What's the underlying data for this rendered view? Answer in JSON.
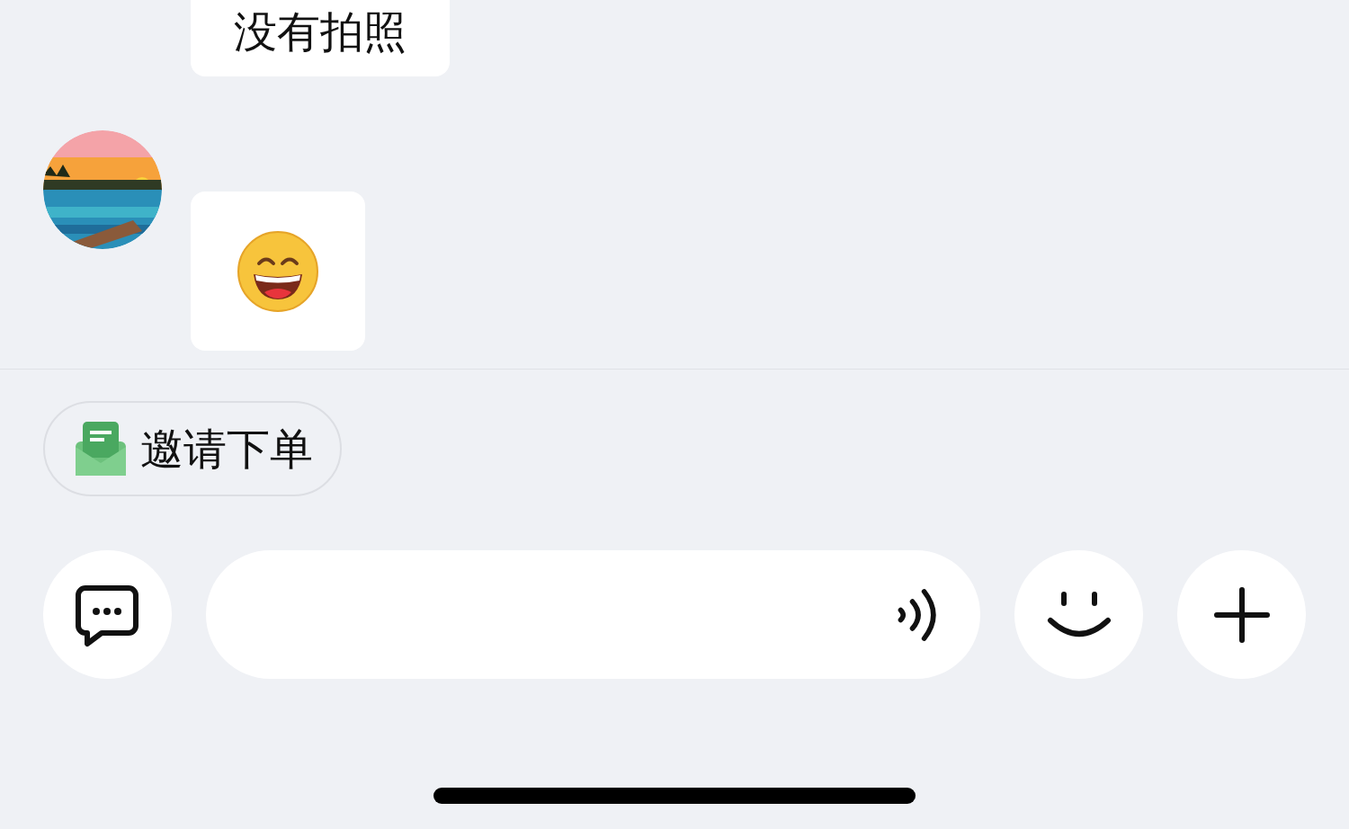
{
  "messages": [
    {
      "kind": "text",
      "text": "没有拍照",
      "avatar": false
    },
    {
      "kind": "emoji",
      "avatar": true
    }
  ],
  "quick_action": {
    "label": "邀请下单"
  }
}
